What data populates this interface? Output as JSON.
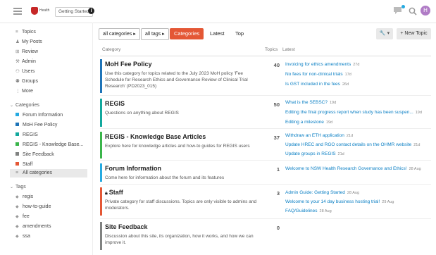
{
  "header": {
    "logo_text": "Health",
    "getting_started": "Getting Started",
    "avatar_letter": "H"
  },
  "sidebar": {
    "nav": [
      {
        "label": "Topics",
        "icon": "topics-icon"
      },
      {
        "label": "My Posts",
        "icon": "user-icon"
      },
      {
        "label": "Review",
        "icon": "review-icon"
      },
      {
        "label": "Admin",
        "icon": "wrench-icon"
      },
      {
        "label": "Users",
        "icon": "users-icon"
      },
      {
        "label": "Groups",
        "icon": "groups-icon"
      },
      {
        "label": "More",
        "icon": "more-icon"
      }
    ],
    "categories_heading": "Categories",
    "categories": [
      {
        "label": "Forum Information",
        "color": "#25aae1"
      },
      {
        "label": "MoH Fee Policy",
        "color": "#1e74b8"
      },
      {
        "label": "REGIS",
        "color": "#12a89d"
      },
      {
        "label": "REGIS - Knowledge Base...",
        "color": "#3ab54a"
      },
      {
        "label": "Site Feedback",
        "color": "#808281"
      },
      {
        "label": "Staff",
        "color": "#e45735"
      }
    ],
    "all_categories": "All categories",
    "tags_heading": "Tags",
    "tags": [
      "regis",
      "how-to-guide",
      "fee",
      "amendments",
      "ssa"
    ]
  },
  "nav_bar": {
    "categories_dropdown": "all categories ▸",
    "tags_dropdown": "all tags ▸",
    "pills": [
      "Categories",
      "Latest",
      "Top"
    ],
    "new_topic": "+ New Topic",
    "wrench": "🔧 ▾"
  },
  "table": {
    "col_category": "Category",
    "col_topics": "Topics",
    "col_latest": "Latest",
    "rows": [
      {
        "name": "MoH Fee Policy",
        "color": "#1e74b8",
        "desc": "Use this category for topics related to the July 2023 MoH policy 'Fee Schedule for Research Ethics and Governance Review of Clinical Trial Research' (PD2023_015)",
        "topics": "40",
        "latest": [
          {
            "title": "Invoicing for ethics amendments",
            "age": "27d"
          },
          {
            "title": "No fees for non-clinical trials",
            "age": "17d"
          },
          {
            "title": "Is GST included in the fees",
            "age": "26d"
          }
        ]
      },
      {
        "name": "REGIS",
        "color": "#12a89d",
        "desc": "Questions on anything about REGIS",
        "topics": "50",
        "latest": [
          {
            "title": "What is the SEBSC?",
            "age": "19d"
          },
          {
            "title": "Editing the final progress report when study has been suspen...",
            "age": "19d"
          },
          {
            "title": "Editing a milestone",
            "age": "19d"
          }
        ]
      },
      {
        "name": "REGIS - Knowledge Base Articles",
        "color": "#3ab54a",
        "desc": "Explore here for knowledge articles and how-to guides for REGIS users",
        "topics": "37",
        "latest": [
          {
            "title": "Withdraw an ETH application",
            "age": "21d"
          },
          {
            "title": "Update HREC and RGO contact details on the OHMR website",
            "age": "21d"
          },
          {
            "title": "Update groups in REGIS",
            "age": "21d"
          }
        ]
      },
      {
        "name": "Forum Information",
        "color": "#25aae1",
        "desc": "Come here for information about the forum and its features",
        "topics": "1",
        "latest": [
          {
            "title": "Welcome to NSW Health Research Governance and Ethics!",
            "age": "28 Aug"
          }
        ]
      },
      {
        "name": "Staff",
        "color": "#e45735",
        "desc": "Private category for staff discussions. Topics are only visible to admins and moderators.",
        "topics": "3",
        "latest": [
          {
            "title": "Admin Guide: Getting Started",
            "age": "28 Aug"
          },
          {
            "title": "Welcome to your 14 day business hosting trial!",
            "age": "29 Aug"
          },
          {
            "title": "FAQ/Guidelines",
            "age": "28 Aug"
          }
        ]
      },
      {
        "name": "Site Feedback",
        "color": "#808281",
        "desc": "Discussion about this site, its organization, how it works, and how we can improve it.",
        "topics": "0",
        "latest": []
      }
    ]
  }
}
